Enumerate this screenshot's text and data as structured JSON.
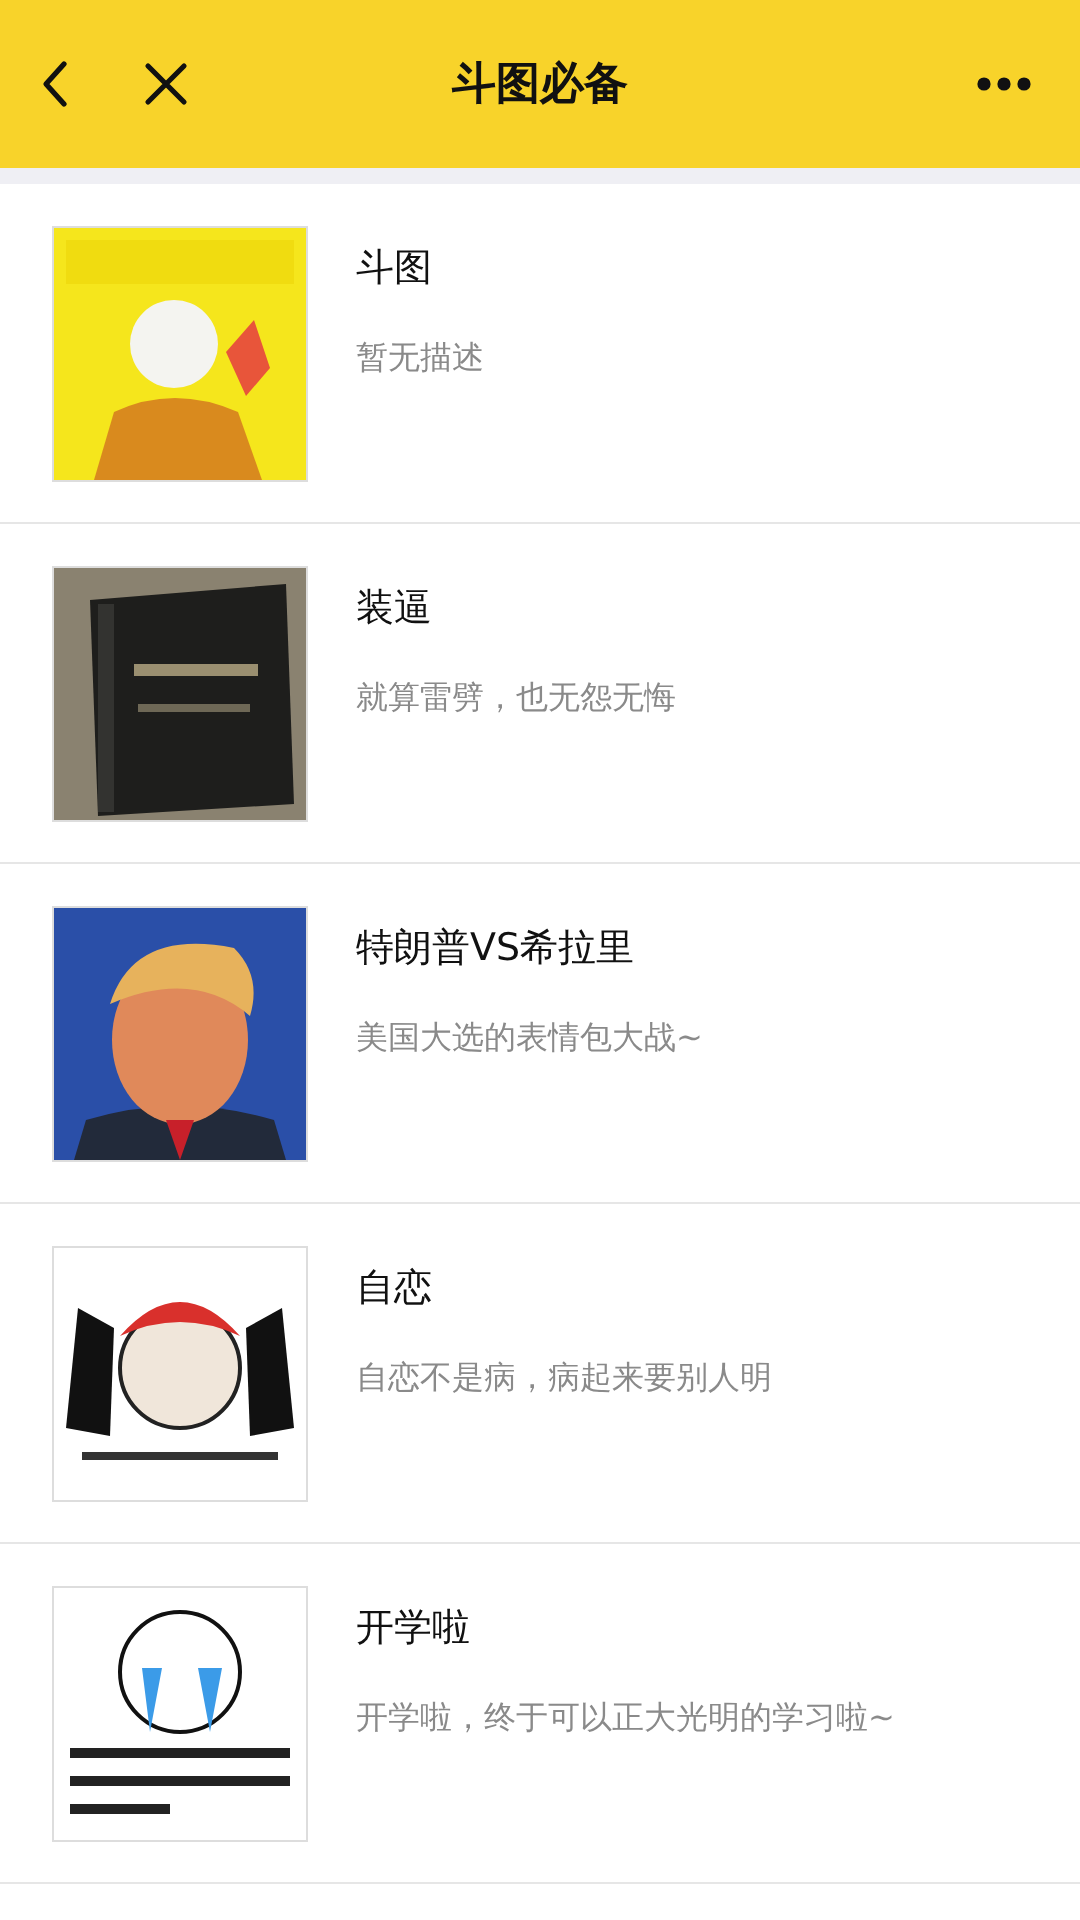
{
  "nav_bar": {
    "title": "斗图必备"
  },
  "items": [
    {
      "title": "斗图",
      "description": "暂无描述"
    },
    {
      "title": "装逼",
      "description": "就算雷劈，也无怨无悔"
    },
    {
      "title": "特朗普VS希拉里",
      "description": "美国大选的表情包大战~"
    },
    {
      "title": "自恋",
      "description": "自恋不是病，病起来要别人明"
    },
    {
      "title": "开学啦",
      "description": "开学啦，终于可以正大光明的学习啦~"
    }
  ]
}
